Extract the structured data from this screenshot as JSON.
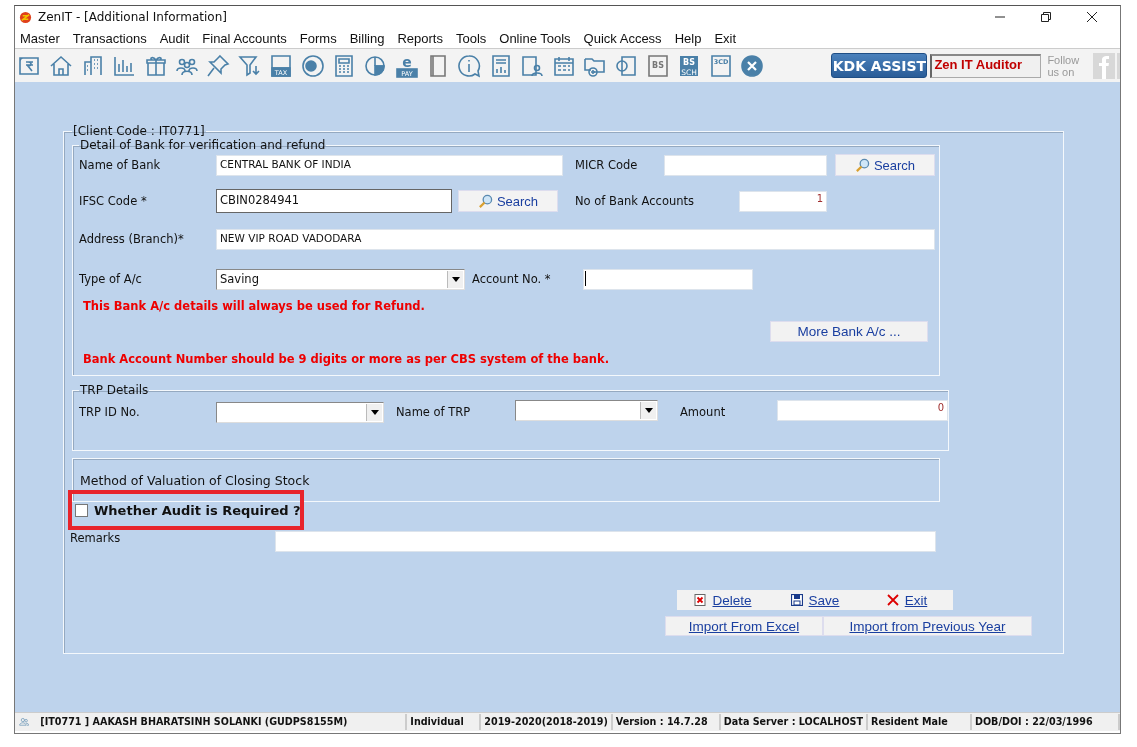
{
  "window": {
    "title": "ZenIT - [Additional Information]"
  },
  "menu": [
    "Master",
    "Transactions",
    "Audit",
    "Final Accounts",
    "Forms",
    "Billing",
    "Reports",
    "Tools",
    "Online Tools",
    "Quick Access",
    "Help",
    "Exit"
  ],
  "toolbar": [
    {
      "kind": "rupee"
    },
    {
      "kind": "home"
    },
    {
      "kind": "building"
    },
    {
      "kind": "bar-chart"
    },
    {
      "kind": "gift"
    },
    {
      "kind": "people"
    },
    {
      "kind": "pin"
    },
    {
      "kind": "filter"
    },
    {
      "kind": "tax",
      "texts": [
        "TAX"
      ]
    },
    {
      "kind": "disc"
    },
    {
      "kind": "calculator"
    },
    {
      "kind": "pie"
    },
    {
      "kind": "epay",
      "texts": [
        "e",
        "PAY"
      ]
    },
    {
      "kind": "book"
    },
    {
      "kind": "info"
    },
    {
      "kind": "report"
    },
    {
      "kind": "user-doc"
    },
    {
      "kind": "calendar"
    },
    {
      "kind": "folder-add"
    },
    {
      "kind": "copy"
    },
    {
      "kind": "bs",
      "texts": [
        "BS"
      ]
    },
    {
      "kind": "bs-sch",
      "texts": [
        "BS",
        "SCH"
      ]
    },
    {
      "kind": "form",
      "texts": [
        "3CD"
      ]
    },
    {
      "kind": "close"
    }
  ],
  "kdk_button": "KDK ASSIST",
  "auditor_field": "Zen IT Auditor",
  "follow_text": "Follow us on",
  "form": {
    "client_code": "[Client Code : IT0771]",
    "bank": {
      "legend": "Detail of Bank for verification and refund",
      "name_label": "Name of Bank",
      "name_value": "CENTRAL BANK OF INDIA",
      "micr_label": "MICR Code",
      "search_1": "Search",
      "ifsc_label": "IFSC Code *",
      "ifsc_value": "CBIN0284941",
      "search_2": "Search",
      "accounts_label": "No of Bank Accounts",
      "accounts_value": "1",
      "address_label": "Address (Branch)*",
      "address_value": "NEW VIP ROAD VADODARA",
      "type_label": "Type of A/c",
      "type_value": "Saving",
      "account_no_label": "Account No. *",
      "account_no_focused": true,
      "refund_note": "This Bank A/c details will always be used for Refund.",
      "more_button": "More Bank A/c ...",
      "digits_note": "Bank Account Number should be 9 digits or more as per CBS system of the bank."
    },
    "trp": {
      "legend": "TRP Details",
      "id_label": "TRP ID No.",
      "name_label": "Name of TRP",
      "amount_label": "Amount",
      "amount_value": "0"
    },
    "stock_label": "Method of Valuation of Closing Stock",
    "audit": {
      "label": "Whether Audit is Required ?",
      "checked": false,
      "highlighted": true
    },
    "remarks_label": "Remarks",
    "buttons": [
      "Delete",
      "Save",
      "Exit"
    ],
    "import_buttons": [
      "Import From Excel",
      "Import from Previous Year"
    ]
  },
  "status_bar": [
    "[IT0771 ] AAKASH BHARATSINH SOLANKI (GUDPS8155M)",
    "Individual",
    "2019-2020(2018-2019)",
    "Version : 14.7.28",
    "Data Server : LOCALHOST",
    "Resident Male",
    "DOB/DOI : 22/03/1996"
  ]
}
